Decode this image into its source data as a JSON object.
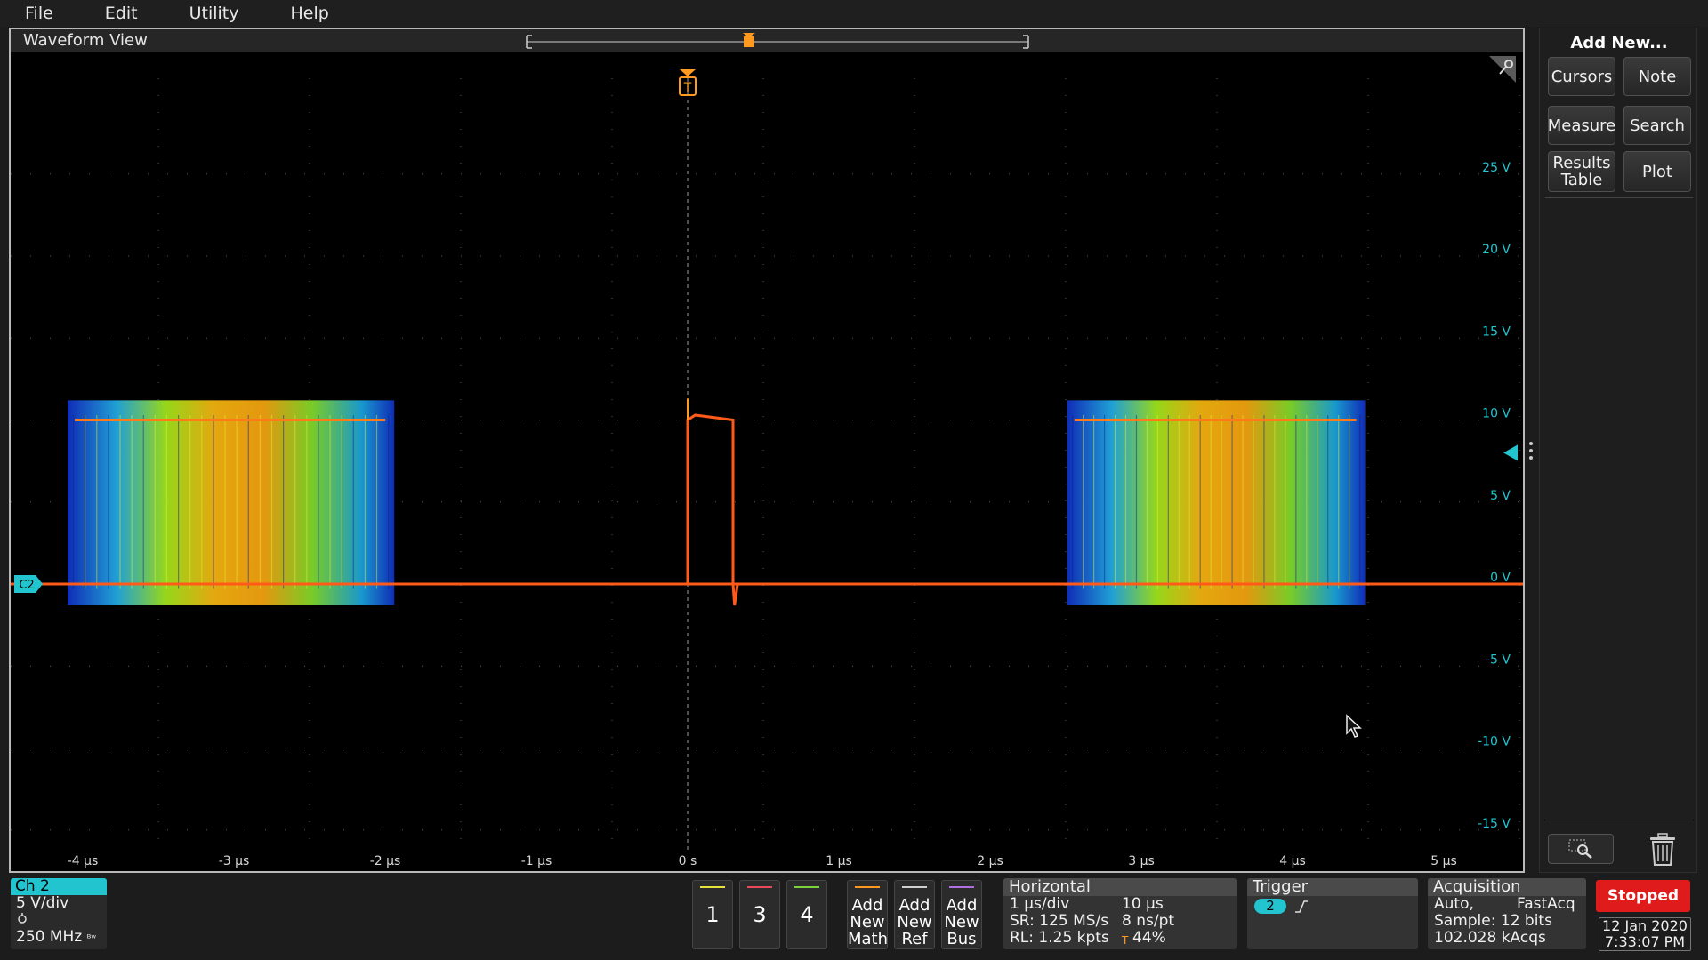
{
  "menu": {
    "items": [
      "File",
      "Edit",
      "Utility",
      "Help"
    ]
  },
  "waveform_view": {
    "title": "Waveform View",
    "channel_tag": "C2",
    "trigger_marker": "T",
    "y_axis": {
      "labels": [
        "25 V",
        "20 V",
        "15 V",
        "10 V",
        "5 V",
        "0 V",
        "-5 V",
        "-10 V",
        "-15 V"
      ],
      "values": [
        25,
        20,
        15,
        10,
        5,
        0,
        -5,
        -10,
        -15
      ]
    },
    "x_axis": {
      "labels": [
        "-4 µs",
        "-3 µs",
        "-2 µs",
        "-1 µs",
        "0 s",
        "1 µs",
        "2 µs",
        "3 µs",
        "4 µs",
        "5 µs"
      ],
      "values": [
        -4,
        -3,
        -2,
        -1,
        0,
        1,
        2,
        3,
        4,
        5
      ]
    },
    "colors": {
      "background": "#000000",
      "grid": "#5a5a5a",
      "channel": "#22c4d0",
      "trigger": "#ff9a1f",
      "trace": "#ff5a1a"
    }
  },
  "side_panel": {
    "title": "Add New...",
    "buttons": [
      {
        "label": "Cursors"
      },
      {
        "label": "Note"
      },
      {
        "label": "Measure"
      },
      {
        "label": "Search"
      },
      {
        "label": "Results Table"
      },
      {
        "label": "Plot"
      }
    ]
  },
  "channel_badge": {
    "name": "Ch 2",
    "scale": "5 V/div",
    "bandwidth": "250 MHz",
    "color": "#22c4d0"
  },
  "channel_buttons": [
    {
      "label": "1",
      "color": "#e6e33a"
    },
    {
      "label": "3",
      "color": "#e8485a"
    },
    {
      "label": "4",
      "color": "#7bd23a"
    }
  ],
  "add_buttons": [
    {
      "label_line1": "Add",
      "label_line2": "New",
      "label_line3": "Math",
      "color": "#ff9a1f"
    },
    {
      "label_line1": "Add",
      "label_line2": "New",
      "label_line3": "Ref",
      "color": "#d0d0d0"
    },
    {
      "label_line1": "Add",
      "label_line2": "New",
      "label_line3": "Bus",
      "color": "#b070e0"
    }
  ],
  "horizontal": {
    "title": "Horizontal",
    "scale": "1 µs/div",
    "position": "10 µs",
    "sample_rate": "SR: 125 MS/s",
    "resolution": "8 ns/pt",
    "record_length": "RL: 1.25 kpts",
    "trigger_pos": "44%"
  },
  "trigger": {
    "title": "Trigger",
    "source": "2"
  },
  "acquisition": {
    "title": "Acquisition",
    "mode": "Auto,",
    "acq_type": "FastAcq",
    "sample": "Sample: 12 bits",
    "count": "102.028 kAcqs"
  },
  "run_state": {
    "label": "Stopped",
    "color": "#e01b1b"
  },
  "datetime": {
    "date": "12 Jan 2020",
    "time": "7:33:07 PM"
  }
}
